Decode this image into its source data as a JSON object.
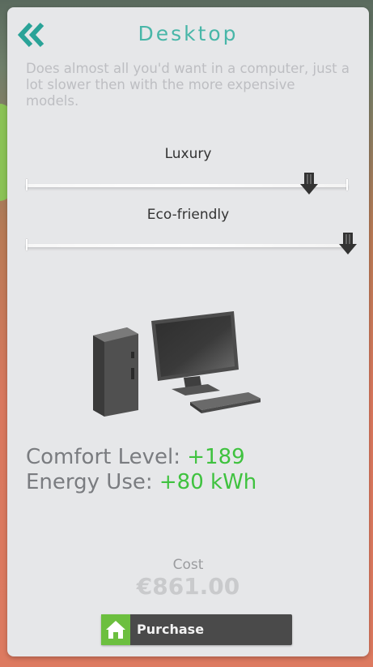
{
  "header": {
    "title": "Desktop",
    "back_icon": "double-chevron-left-icon",
    "accent_color": "#48b6a8"
  },
  "description": "Does almost all you'd want in a computer, just a lot slower then with the more expensive models.",
  "sliders": [
    {
      "label": "Luxury",
      "value": 0.88
    },
    {
      "label": "Eco-friendly",
      "value": 1.0
    }
  ],
  "product_image": "desktop-computer-icon",
  "stats": {
    "comfort_label": "Comfort Level:",
    "comfort_value": "+189",
    "energy_label": "Energy Use:",
    "energy_value": "+80 kWh",
    "value_color": "#3fc23f"
  },
  "cost": {
    "label": "Cost",
    "value": "€861.00"
  },
  "purchase": {
    "label": "Purchase",
    "icon": "home-icon",
    "icon_color": "#6cbf3f"
  }
}
